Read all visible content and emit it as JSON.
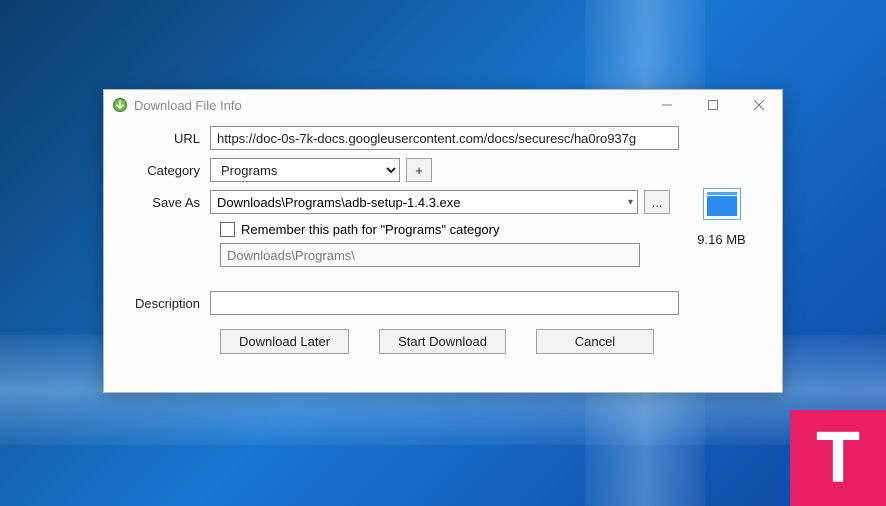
{
  "window": {
    "title": "Download File Info"
  },
  "form": {
    "url_label": "URL",
    "url_value": "https://doc-0s-7k-docs.googleusercontent.com/docs/securesc/ha0ro937g",
    "category_label": "Category",
    "category_value": "Programs",
    "add_category_label": "+",
    "saveas_label": "Save As",
    "saveas_value": "Downloads\\Programs\\adb-setup-1.4.3.exe",
    "browse_label": "...",
    "remember_label": "Remember this path for \"Programs\" category",
    "remember_path": "Downloads\\Programs\\",
    "description_label": "Description",
    "description_value": ""
  },
  "buttons": {
    "later": "Download Later",
    "start": "Start Download",
    "cancel": "Cancel"
  },
  "file": {
    "size": "9.16  MB"
  },
  "watermark": "T"
}
